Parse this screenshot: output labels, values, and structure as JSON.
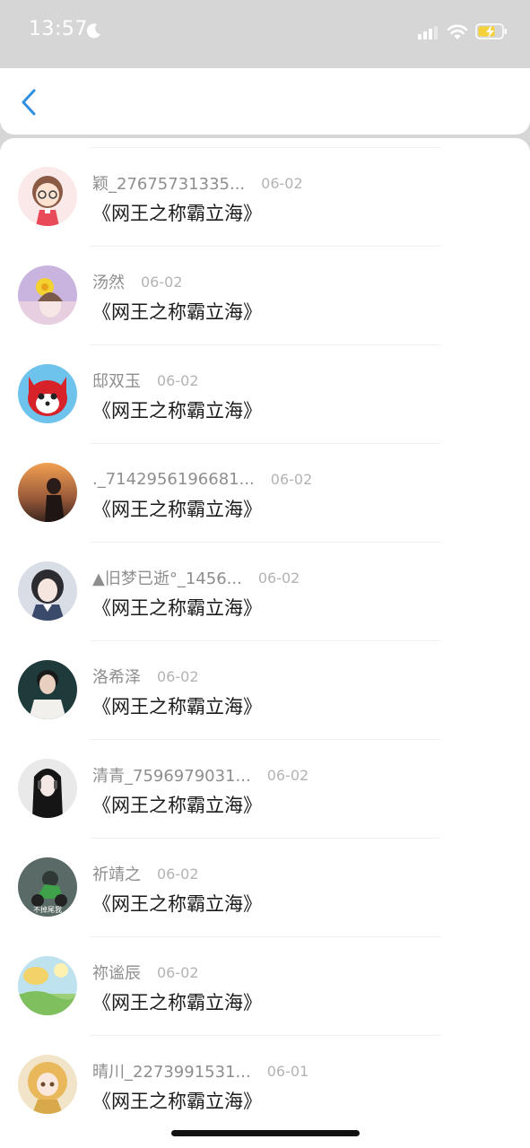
{
  "status_bar": {
    "time": "13:57"
  },
  "nav": {
    "back_icon": "chevron-left-icon"
  },
  "items": [
    {
      "name": "颖_27675731335...",
      "date": "06-02",
      "message": "《网王之称霸立海》",
      "avatar_icon": "avatar-cartoon-girl-glasses"
    },
    {
      "name": "汤然",
      "date": "06-02",
      "message": "《网王之称霸立海》",
      "avatar_icon": "avatar-girl-flower"
    },
    {
      "name": "邸双玉",
      "date": "06-02",
      "message": "《网王之称霸立海》",
      "avatar_icon": "avatar-red-fox-cartoon"
    },
    {
      "name": "._7142956196681...",
      "date": "06-02",
      "message": "《网王之称霸立海》",
      "avatar_icon": "avatar-sunset-girl"
    },
    {
      "name": "▲旧梦已逝°_1456...",
      "date": "06-02",
      "message": "《网王之称霸立海》",
      "avatar_icon": "avatar-girl-portrait"
    },
    {
      "name": "洛希泽",
      "date": "06-02",
      "message": "《网王之称霸立海》",
      "avatar_icon": "avatar-boy-portrait"
    },
    {
      "name": "清青_7596979031...",
      "date": "06-02",
      "message": "《网王之称霸立海》",
      "avatar_icon": "avatar-girl-headphones"
    },
    {
      "name": "祈靖之",
      "date": "06-02",
      "message": "《网王之称霸立海》",
      "avatar_icon": "avatar-motorcycle",
      "avatar_caption": "不掉尾我"
    },
    {
      "name": "祢谧辰",
      "date": "06-02",
      "message": "《网王之称霸立海》",
      "avatar_icon": "avatar-landscape"
    },
    {
      "name": "晴川_2273991531...",
      "date": "06-01",
      "message": "《网王之称霸立海》",
      "avatar_icon": "avatar-anime-girl-blonde"
    }
  ],
  "colors": {
    "accent": "#2f8fe0",
    "status_bar_bg": "#d6d6d6",
    "name_text": "#8e8e8e",
    "date_text": "#b3b3b3",
    "message_text": "#1a1a1a",
    "battery_fill": "#f5d23a"
  }
}
